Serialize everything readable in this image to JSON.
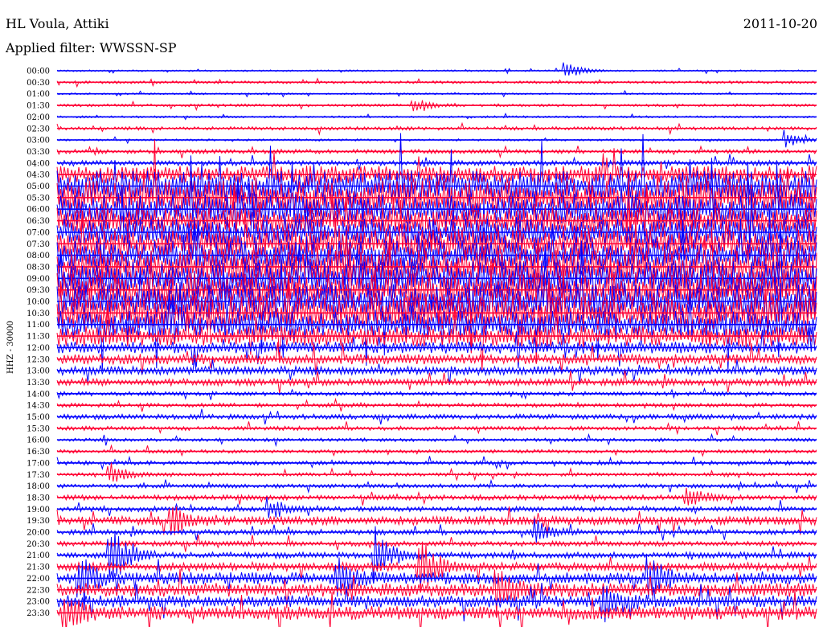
{
  "header": {
    "station": "HL Voula, Attiki",
    "filter": "Applied filter: WWSSN-SP",
    "date": "2011-10-20"
  },
  "chart_data": {
    "type": "line",
    "title": "HL Voula, Attiki",
    "subtitle": "Applied filter: WWSSN-SP",
    "date": "2011-10-20",
    "ylabel": "HHZ - 30000",
    "tick_labels": [
      "00:00",
      "00:30",
      "01:00",
      "01:30",
      "02:00",
      "02:30",
      "03:00",
      "03:30",
      "04:00",
      "04:30",
      "05:00",
      "05:30",
      "06:00",
      "06:30",
      "07:00",
      "07:30",
      "08:00",
      "08:30",
      "09:00",
      "09:30",
      "10:00",
      "10:30",
      "11:00",
      "11:30",
      "12:00",
      "12:30",
      "13:00",
      "13:30",
      "14:00",
      "14:30",
      "15:00",
      "15:30",
      "16:00",
      "16:30",
      "17:00",
      "17:30",
      "18:00",
      "18:30",
      "19:00",
      "19:30",
      "20:00",
      "20:30",
      "21:00",
      "21:30",
      "22:00",
      "22:30",
      "23:00",
      "23:30"
    ],
    "trace_colors": [
      "#0000ff",
      "#ff0033"
    ],
    "noise_level": [
      0.05,
      0.08,
      0.05,
      0.08,
      0.06,
      0.1,
      0.06,
      0.12,
      0.15,
      0.5,
      0.9,
      1.0,
      0.9,
      0.8,
      0.8,
      0.85,
      0.9,
      1.0,
      1.0,
      1.0,
      1.0,
      1.0,
      0.8,
      0.6,
      0.35,
      0.3,
      0.25,
      0.2,
      0.12,
      0.12,
      0.15,
      0.12,
      0.1,
      0.1,
      0.12,
      0.1,
      0.12,
      0.15,
      0.15,
      0.25,
      0.15,
      0.15,
      0.18,
      0.25,
      0.35,
      0.4,
      0.35,
      0.4
    ],
    "events": [
      {
        "row": 0,
        "at": 0.67,
        "size": 0.35
      },
      {
        "row": 3,
        "at": 0.47,
        "size": 0.3
      },
      {
        "row": 6,
        "at": 0.96,
        "size": 0.4
      },
      {
        "row": 9,
        "at": 0.33,
        "size": 0.3
      },
      {
        "row": 35,
        "at": 0.07,
        "size": 0.5
      },
      {
        "row": 37,
        "at": 0.83,
        "size": 0.5
      },
      {
        "row": 38,
        "at": 0.28,
        "size": 0.5
      },
      {
        "row": 39,
        "at": 0.15,
        "size": 0.7
      },
      {
        "row": 40,
        "at": 0.63,
        "size": 0.5
      },
      {
        "row": 42,
        "at": 0.07,
        "size": 1.6
      },
      {
        "row": 42,
        "at": 0.42,
        "size": 1.3
      },
      {
        "row": 43,
        "at": 0.48,
        "size": 1.2
      },
      {
        "row": 44,
        "at": 0.03,
        "size": 0.8
      },
      {
        "row": 44,
        "at": 0.37,
        "size": 0.8
      },
      {
        "row": 44,
        "at": 0.78,
        "size": 0.9
      },
      {
        "row": 45,
        "at": 0.58,
        "size": 0.9
      },
      {
        "row": 46,
        "at": 0.72,
        "size": 0.8
      },
      {
        "row": 47,
        "at": 0.01,
        "size": 0.8
      }
    ]
  }
}
